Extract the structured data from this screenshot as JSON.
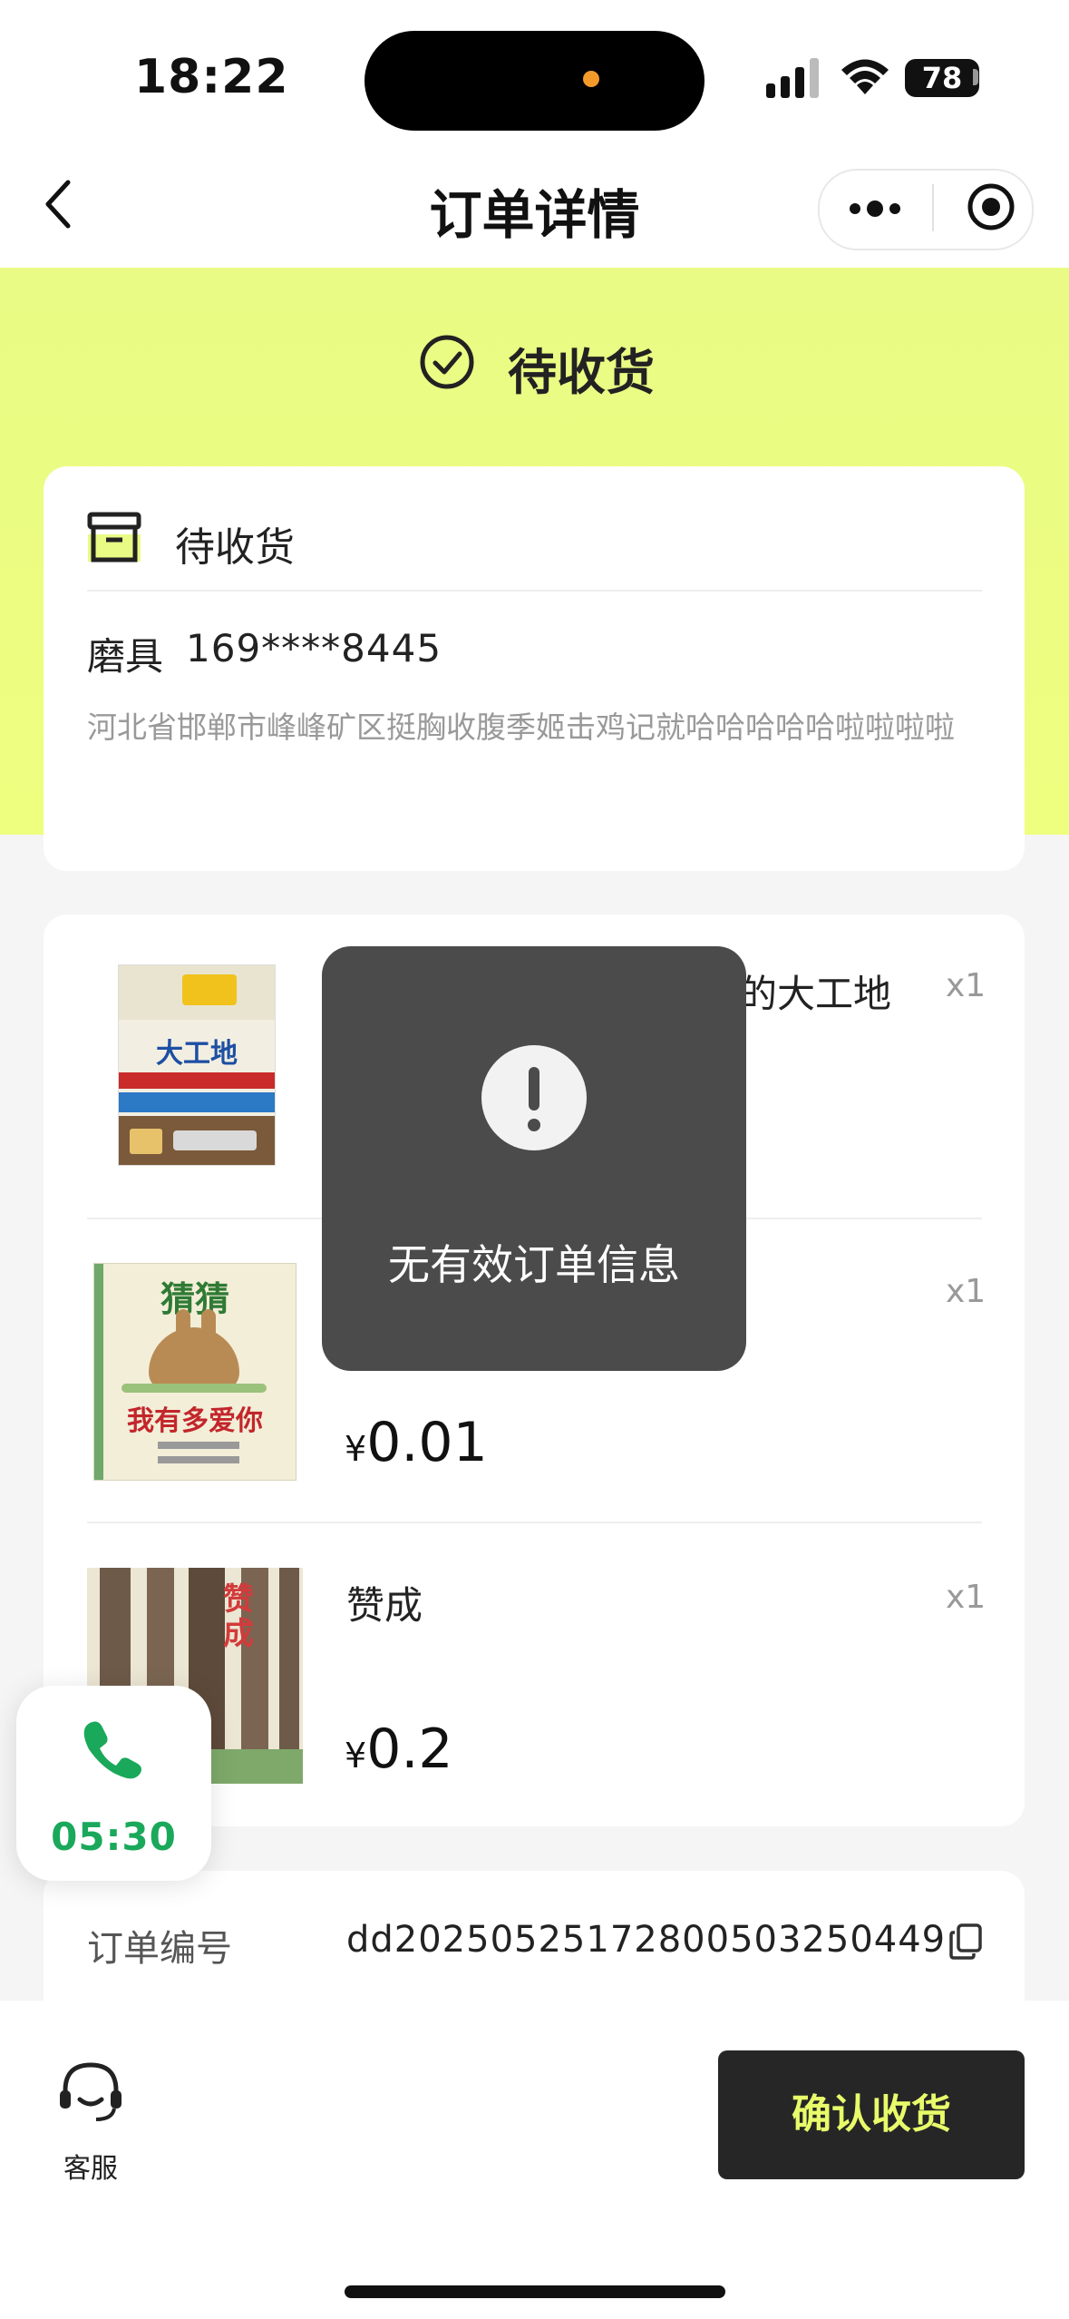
{
  "status_bar": {
    "time": "18:22",
    "battery": "78"
  },
  "nav": {
    "title": "订单详情"
  },
  "order_status": {
    "title": "待收货"
  },
  "address": {
    "status": "待收货",
    "name": "磨具",
    "phone": "169****8445",
    "line": "河北省邯郸市峰峰矿区挺胸收腹季姬击鸡记就哈哈哈哈哈啦啦啦啦"
  },
  "goods": [
    {
      "name_visible": "的大工地",
      "qty": "x1",
      "cover_text": "大工地"
    },
    {
      "qty": "x1",
      "price_symbol": "¥",
      "price": "0.01",
      "cover_text_top": "猜猜",
      "cover_text_bottom": "我有多爱你"
    },
    {
      "name": "赞成",
      "qty": "x1",
      "price_symbol": "¥",
      "price": "0.2",
      "cover_text": "赞成"
    }
  ],
  "order_info": {
    "label": "订单编号",
    "value": "dd20250525172800503250449"
  },
  "bottom": {
    "service_label": "客服",
    "confirm_label": "确认收货"
  },
  "call": {
    "duration": "05:30"
  },
  "toast": {
    "message": "无有效订单信息"
  },
  "colors": {
    "accent_yellow": "#eefe7f",
    "call_green": "#1aa85a",
    "confirm_text": "#e8fb6a"
  }
}
